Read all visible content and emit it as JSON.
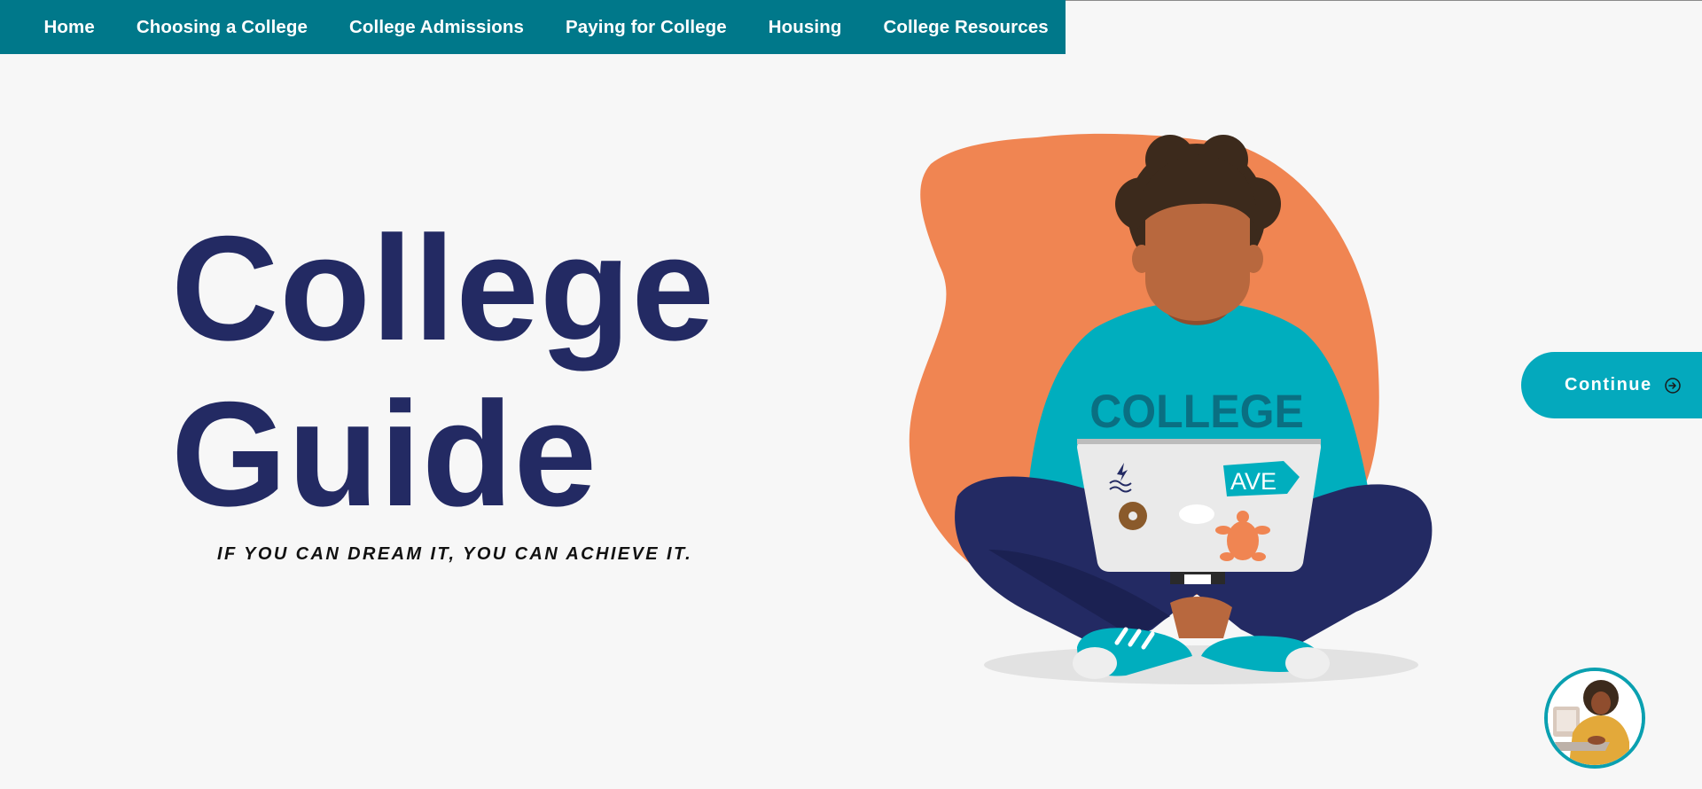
{
  "nav": {
    "items": [
      {
        "label": "Home"
      },
      {
        "label": "Choosing a College"
      },
      {
        "label": "College Admissions"
      },
      {
        "label": "Paying for College"
      },
      {
        "label": "Housing"
      },
      {
        "label": "College Resources"
      }
    ]
  },
  "hero": {
    "title_line1": "College",
    "title_line2": "Guide",
    "tagline": "IF YOU CAN DREAM IT, YOU CAN ACHIEVE IT."
  },
  "illustration": {
    "shirt_text": "COLLEGE",
    "sticker_text": "AVE",
    "icon": "student-with-laptop-illustration"
  },
  "continue_button": {
    "label": "Continue",
    "icon": "arrow-circle-right-icon"
  },
  "chat": {
    "icon": "chat-assistant-avatar"
  },
  "colors": {
    "nav_bg": "#00788a",
    "title": "#232a63",
    "accent": "#04a9bd",
    "blob": "#f08552",
    "background": "#f7f7f7"
  }
}
